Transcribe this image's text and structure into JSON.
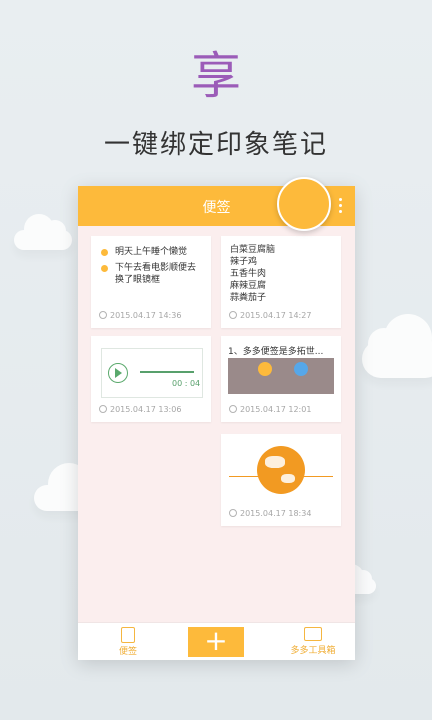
{
  "hero": {
    "big_char": "享",
    "subtitle": "一键绑定印象笔记"
  },
  "appbar": {
    "title": "便签"
  },
  "cards": {
    "todo": {
      "lines": [
        "明天上午睡个懒觉",
        "下午去看电影顺便去",
        "换了眼镜框"
      ],
      "timestamp": "2015.04.17 14:36"
    },
    "list": {
      "lines": [
        "白菜豆腐脑",
        "辣子鸡",
        "五香牛肉",
        "麻辣豆腐",
        "蒜粪茄子"
      ],
      "timestamp": "2015.04.17 14:27"
    },
    "audio": {
      "time": "00 : 04",
      "timestamp": "2015.04.17 13:06"
    },
    "tools": {
      "title": "1、多多便签是多拓世...",
      "timestamp": "2015.04.17 12:01"
    },
    "image": {
      "timestamp": "2015.04.17 18:34"
    }
  },
  "bottom_bar": {
    "notes_label": "便签",
    "add_label": "+",
    "tools_label": "多多工具箱"
  },
  "colors": {
    "accent": "#fdba3b",
    "purple": "#9b5cb8",
    "green": "#58a06c"
  }
}
